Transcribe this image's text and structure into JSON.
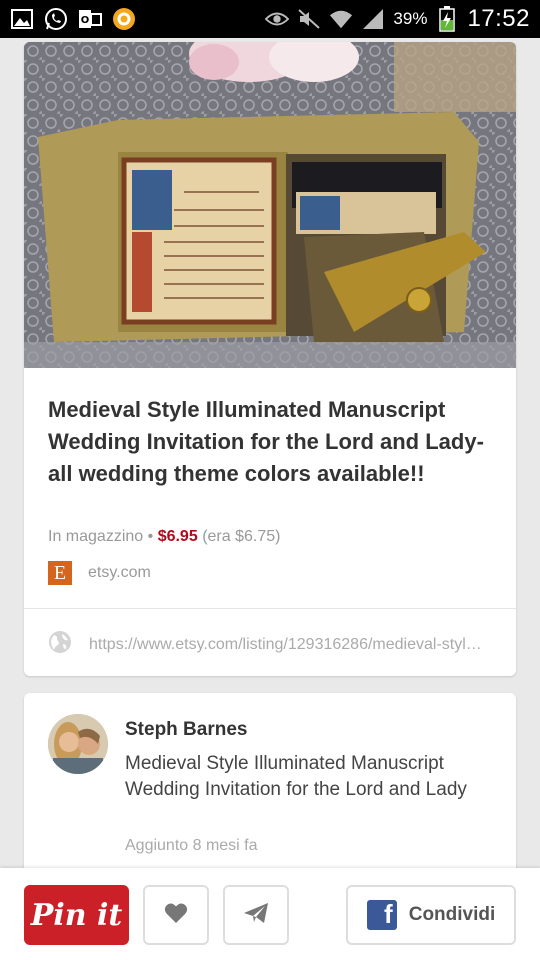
{
  "status_bar": {
    "battery_percent": "39%",
    "time": "17:52"
  },
  "product": {
    "title": "Medieval Style Illuminated Manuscript Wedding Invitation for the Lord and Lady- all wedding theme colors available!!",
    "stock": "In magazzino",
    "separator": "•",
    "price": "$6.95",
    "was_price": "(era $6.75)",
    "domain_badge": "E",
    "domain": "etsy.com",
    "url": "https://www.etsy.com/listing/129316286/medieval-style-illuminated-manuscript"
  },
  "pin": {
    "author": "Steph Barnes",
    "description": "Medieval Style Illuminated Manuscript Wedding Invitation for the Lord and Lady",
    "added": "Aggiunto 8 mesi fa"
  },
  "actions": {
    "pinit_label": "Pin it",
    "share_label": "Condividi",
    "fb_glyph": "f"
  },
  "colors": {
    "pinit_red": "#cb2027",
    "price_red": "#b7081b",
    "facebook_blue": "#3b5998",
    "etsy_orange": "#d5641c"
  },
  "icons": [
    "gallery-icon",
    "whatsapp-icon",
    "outlook-icon",
    "app-icon",
    "eye-icon",
    "mute-icon",
    "wifi-icon",
    "signal-icon",
    "battery-icon",
    "globe-icon",
    "heart-icon",
    "send-icon",
    "facebook-icon"
  ]
}
